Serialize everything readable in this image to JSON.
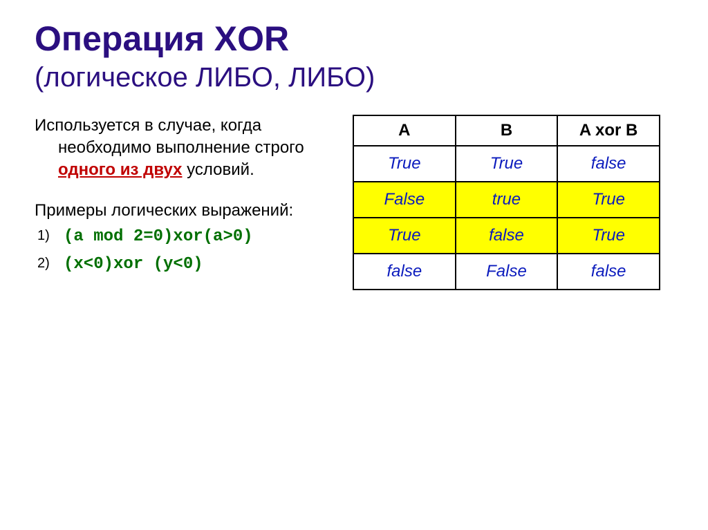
{
  "title": {
    "main": "Операция  XOR",
    "sub": "(логическое ЛИБО, ЛИБО)"
  },
  "intro": {
    "lead": "Используется в случае, когда необходимо выполнение строго  ",
    "accent": "одного из двух",
    "tail": " условий."
  },
  "examples_label": "Примеры логических выражений:",
  "examples": [
    "(a mod 2=0)xor(a>0)",
    "(x<0)xor (y<0)"
  ],
  "table": {
    "headers": [
      "A",
      "B",
      "A xor B"
    ],
    "rows": [
      {
        "cells": [
          "True",
          "True",
          "false"
        ],
        "highlight": false
      },
      {
        "cells": [
          "False",
          "true",
          "True"
        ],
        "highlight": true
      },
      {
        "cells": [
          "True",
          "false",
          "True"
        ],
        "highlight": true
      },
      {
        "cells": [
          "false",
          "False",
          "false"
        ],
        "highlight": false
      }
    ]
  }
}
